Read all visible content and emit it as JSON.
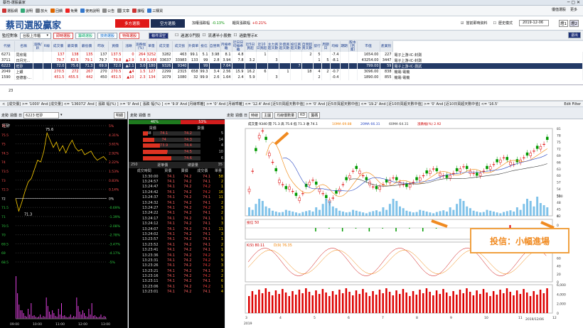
{
  "window_title": "蔡司-選股贏家",
  "toolbar": [
    {
      "label": "選股網",
      "color": "#c33"
    },
    {
      "label": "說明",
      "color": "#3a7"
    },
    {
      "label": "放大",
      "color": "#888"
    },
    {
      "label": "回饋",
      "color": "#d60"
    },
    {
      "label": "免費",
      "color": "#e22"
    },
    {
      "label": "使用說明",
      "color": "#37c"
    },
    {
      "label": "公告",
      "color": "#888"
    },
    {
      "label": "文章",
      "color": "#888"
    },
    {
      "label": "課程",
      "color": "#c33"
    },
    {
      "label": "三購買",
      "color": "#37c"
    }
  ],
  "top_right": {
    "user": "優值選股",
    "update": "更多"
  },
  "banner": {
    "logo": "蔡司選股贏家",
    "tab_long": "多方選股",
    "tab_short": "空方選股",
    "up_label": "加權漲跌幅",
    "up_val": "-0.13%",
    "otc_label": "櫃買漲跌幅",
    "otc_val": "+0.21%",
    "chk_auto": "當前即時資料",
    "chk_hist": "歷史模式",
    "date": "2019-12-06",
    "view1": "燈1",
    "view2": "燈2",
    "exit": "退出"
  },
  "filter": {
    "label": "監控對象",
    "market": "台股上市櫃",
    "btns": [
      "即時選股",
      "籌碼選股",
      "技術選股",
      "特殊選股"
    ],
    "clear": "條件清空",
    "c1": "過濾冷門股",
    "c2": "流通半小股數",
    "c3": "過動警示K"
  },
  "grid": {
    "headers": [
      "代號",
      "名稱",
      "漲跌/趴",
      "K線",
      "成交價",
      "最高價",
      "最低價",
      "昨收",
      "買價",
      "漲跌",
      "漲跌幅(%)",
      "單量",
      "成交量",
      "成交張",
      "外資單",
      "投信",
      "自營商",
      "月線乖離",
      "近日日均線乖離",
      "近5日買超",
      "近10日買超",
      "主力買超天數",
      "外資買超天數",
      "投信買超天數",
      "自營超買天數",
      "發行",
      "周期日",
      "均線",
      "期期",
      "股本(百萬)",
      "市值",
      "產業別"
    ],
    "rows": [
      {
        "sel": false,
        "c": [
          "6271",
          "同欣電",
          "",
          "",
          "137",
          "138",
          "135",
          "137",
          "137.5",
          "0",
          "264",
          "3252",
          "3282",
          "463",
          "99.1",
          "5.1",
          "3.98",
          "8.1",
          "4.8",
          "",
          "1",
          "",
          "",
          "",
          "2",
          "5",
          "",
          "-7.4",
          "",
          "",
          "1654.00",
          "227",
          "電子上游-IC-封測"
        ]
      },
      {
        "sel": false,
        "c": [
          "3711",
          "日月光...",
          "",
          "",
          "79.7",
          "82.5",
          "79.1",
          "79.7",
          "79.8",
          "▲2.9",
          "3.8",
          "1,066",
          "33637",
          "33983",
          "133",
          "99",
          "2.8",
          "3.94",
          "7.8",
          "3.2",
          "",
          "3",
          "",
          "",
          "",
          "1",
          "5",
          "-8.1",
          "",
          "",
          "43254.00",
          "3447",
          "電子上游-IC-封測"
        ]
      },
      {
        "sel": true,
        "c": [
          "6223",
          "旺矽",
          "",
          "",
          "72.0",
          "75.6",
          "71.3",
          "69.9",
          "72.0",
          "▲2.1",
          "3.0",
          "180",
          "9326",
          "9340",
          "",
          "99",
          "",
          "7.64",
          "",
          "",
          "",
          "",
          "",
          "7",
          "",
          "",
          "",
          "",
          "",
          "",
          "799.00",
          "59",
          "電子上游-IC-測試"
        ]
      },
      {
        "sel": false,
        "c": [
          "2049",
          "上銀",
          "",
          "",
          "270.5",
          "272",
          "267",
          "270",
          "270.5",
          "▲4",
          "1.5",
          "127",
          "2299",
          "2315",
          "658",
          "99.3",
          "3.4",
          "2.56",
          "15.9",
          "16.2",
          "6",
          "",
          "1",
          "",
          "18",
          "4",
          "2",
          "-0.7",
          "",
          "",
          "3096.00",
          "838",
          "機電-電機"
        ]
      },
      {
        "sel": false,
        "c": [
          "1590",
          "亞德客-...",
          "",
          "",
          "451.5",
          "455.5",
          "442",
          "450",
          "451.5",
          "▲10",
          "2.3",
          "134",
          "1079",
          "1080",
          "32",
          "99.9",
          "2.6",
          "1.64",
          "2.4",
          "5.9",
          "",
          "3",
          "",
          "",
          "",
          "2",
          "",
          "-0.4",
          "",
          "",
          "1890.00",
          "855",
          "機電-電機"
        ]
      }
    ],
    "count": "23"
  },
  "condition": "[成交價] >= '1000' And [成交量] <= '136072' And [ 漲跌  幅(%) ] >= '0' And [ 漲跌  幅(%) ] <= '9.9' And [月線乖離] >= '0' And [月線乖離] <= '12.4' And [近5日買超天數中值] >= '0' And [近5日買超天數中值] <= '19.2' And [近10日買超天數中值] >= '0' And [近10日買超天數中值] <= '16.5'",
  "edit_filter": "Edit Filter",
  "intraday": {
    "tabs": [
      "走勢",
      "週價",
      "日"
    ],
    "stock": "6223 旺矽",
    "button": "明細",
    "name": "旺矽",
    "hi": "75.6",
    "lo": "71.3",
    "ref": "72",
    "prices": [
      "76",
      "75.5",
      "75",
      "74.5",
      "74",
      "73.5",
      "73",
      "72.5",
      "72",
      "71.5",
      "71",
      "70.5",
      "70",
      "69.5",
      "69",
      "68.5"
    ],
    "pcts": [
      "5%",
      "4.31%",
      "3.61%",
      "2.92%",
      "2.22%",
      "1.53%",
      "0.83%",
      "0.14%",
      "0%",
      "-0.69%",
      "-1.39%",
      "-2.08%",
      "-2.78%",
      "-3.47%",
      "-4.17%",
      "-5%"
    ],
    "times": [
      "09:00",
      "10:00",
      "11:00",
      "12:00",
      "13:00"
    ]
  },
  "book": {
    "tabs": [
      "走勢",
      "週價",
      "日"
    ],
    "bid_pct": "46%",
    "ask_pct": "53%",
    "bid_label": "買價",
    "ask_label": "賣價",
    "rows": [
      {
        "bq": "38",
        "bp": "74.1",
        "ap": "74.2",
        "aq": "5"
      },
      {
        "bq": "33",
        "bp": "74",
        "ap": "74.3",
        "aq": "14"
      },
      {
        "bq": "8",
        "bp": "73.9",
        "ap": "74.4",
        "aq": "4"
      },
      {
        "bq": "58",
        "bp": "73.8",
        "ap": "74.5",
        "aq": "10"
      },
      {
        "bq": "95",
        "bp": "73.7",
        "ap": "74.6",
        "aq": "6"
      }
    ],
    "sub": {
      "a": "250",
      "b": "逐筆價",
      "c": "總委量",
      "d": "35"
    },
    "tick_headers": [
      "成交時間",
      "買價",
      "賣價",
      "成交價",
      "單量"
    ],
    "ticks": [
      [
        "13:30:00",
        "74.1",
        "74.2",
        "74.1",
        "58"
      ],
      [
        "13:24:57",
        "74.1",
        "74.2",
        "74.1",
        "2"
      ],
      [
        "13:24:47",
        "74.1",
        "74.2",
        "74.2",
        "1"
      ],
      [
        "13:24:42",
        "74.1",
        "74.2",
        "74.2",
        "16"
      ],
      [
        "13:24:37",
        "74.1",
        "74.2",
        "74.1",
        "11"
      ],
      [
        "13:24:32",
        "74.1",
        "74.2",
        "74.1",
        "2"
      ],
      [
        "13:24:27",
        "74.1",
        "74.2",
        "74.2",
        "3"
      ],
      [
        "13:24:22",
        "74.1",
        "74.2",
        "74.1",
        "2"
      ],
      [
        "13:24:17",
        "74.1",
        "74.2",
        "74.1",
        "1"
      ],
      [
        "13:24:12",
        "74.1",
        "74.2",
        "74.1",
        "3"
      ],
      [
        "13:24:07",
        "74.1",
        "74.2",
        "74.1",
        "11"
      ],
      [
        "13:24:02",
        "74.1",
        "74.2",
        "74.1",
        "3"
      ],
      [
        "13:23:57",
        "74.1",
        "74.2",
        "74.1",
        "1"
      ],
      [
        "13:23:52",
        "74.1",
        "74.2",
        "74.1",
        "2"
      ],
      [
        "13:23:41",
        "74.1",
        "74.2",
        "74.1",
        "1"
      ],
      [
        "13:23:36",
        "74.1",
        "74.2",
        "74.2",
        "9"
      ],
      [
        "13:23:31",
        "74.1",
        "74.2",
        "74.2",
        "5"
      ],
      [
        "13:23:26",
        "74.1",
        "74.2",
        "74.2",
        "3"
      ],
      [
        "13:23:21",
        "74.1",
        "74.2",
        "74.1",
        "3"
      ],
      [
        "13:23:16",
        "74.1",
        "74.2",
        "74.2",
        "2"
      ],
      [
        "13:23:11",
        "74.1",
        "74.2",
        "74.1",
        "6"
      ],
      [
        "13:23:06",
        "74.1",
        "74.2",
        "74.2",
        "1"
      ],
      [
        "13:23:01",
        "74.1",
        "74.2",
        "74.1",
        "4"
      ]
    ]
  },
  "kline": {
    "tabs": [
      "走勢",
      "週價",
      "日"
    ],
    "sel1": "時線",
    "sel2": "主圖",
    "sel3": "均線價數量",
    "sel4": "KD",
    "sel5": "籌碼",
    "legend": "成交量 9340 開 71.3 高 75.6 低 71.3 收 74.1",
    "ma10": "10MA 69.88",
    "ma20": "20MA 66.31",
    "ma60": "60MA 64.31",
    "vol_ma": "漲跌幅(%) 2.92",
    "y_price": [
      "81",
      "78",
      "75",
      "72",
      "69",
      "66",
      "63",
      "60",
      "57",
      "54",
      "51",
      "48",
      "45",
      "42"
    ],
    "y_vol": [
      "500",
      "0"
    ],
    "y_inst": [
      "0",
      "-349.67"
    ],
    "inst_label": "投信 50",
    "kd_label": "K(9) 80.11",
    "d_label": "D(9) 76.35",
    "y_kd": [
      "100",
      "80",
      "60",
      "40",
      "20",
      "0"
    ],
    "y_vol2": [
      "6,000",
      "4,000",
      "2,000",
      "0"
    ],
    "x_months": [
      "3",
      "4",
      "5",
      "6",
      "7",
      "8",
      "9",
      "10",
      "11",
      "12"
    ],
    "year": "2019",
    "last_date": "2019/12/06",
    "callout": "投信：小幅進場"
  }
}
